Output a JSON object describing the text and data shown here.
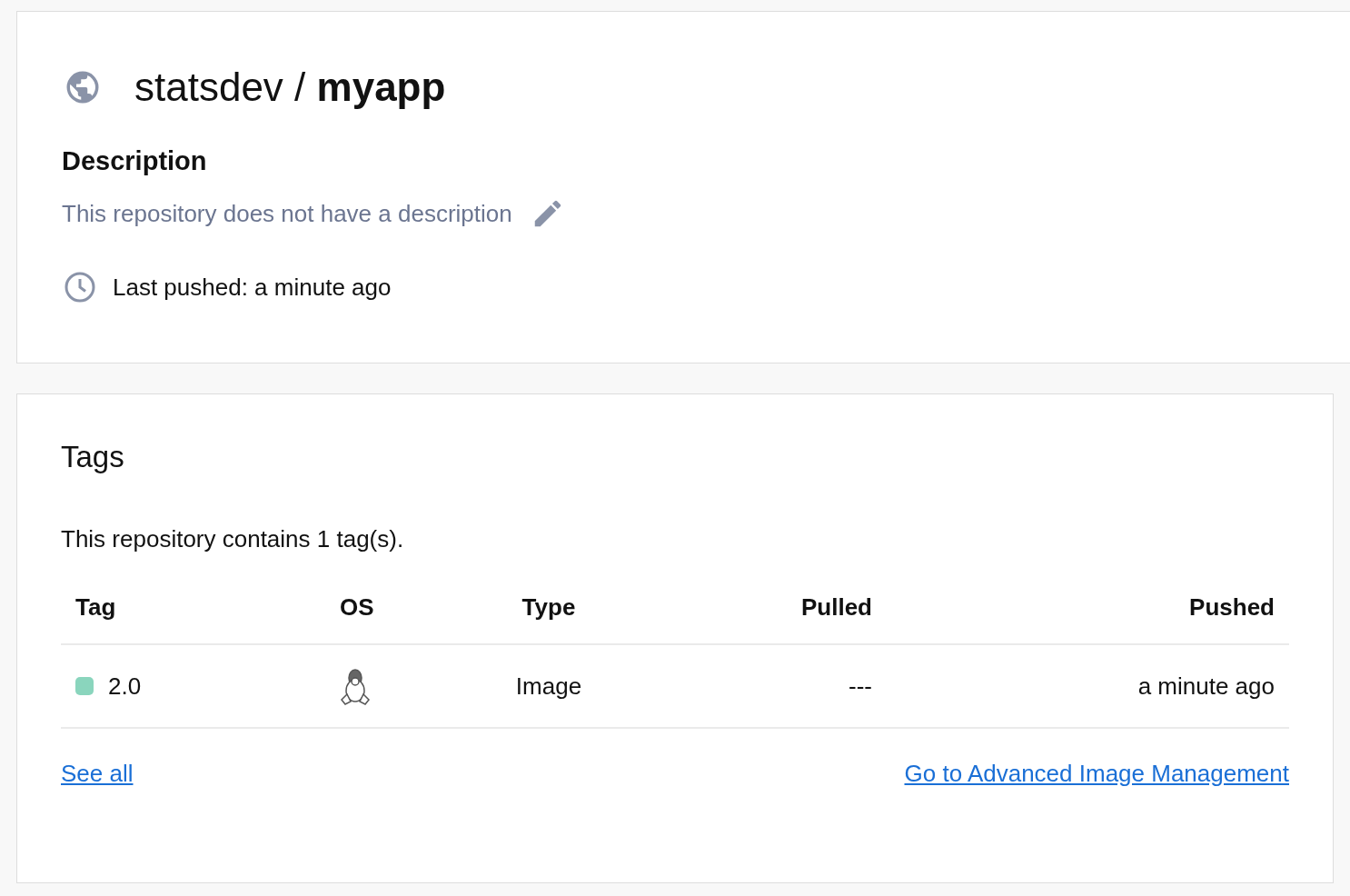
{
  "repository": {
    "title": "statsdev / **myapp**",
    "description_heading": "Description",
    "description": "This repository does not have a description",
    "last_pushed": "Last pushed: a minute ago"
  },
  "tags": {
    "heading": "Tags",
    "summary": "This repository contains 1 tag(s).",
    "columns": [
      "Tag",
      "OS",
      "Type",
      "Pulled",
      "Pushed"
    ],
    "rows": [
      {
        "tag": "2.0",
        "color": "#8ad5bd",
        "type": "Image",
        "pulled": "---",
        "pushed": "a minute ago"
      }
    ],
    "links": [
      "See all",
      "Go to Advanced Image Management"
    ]
  }
}
